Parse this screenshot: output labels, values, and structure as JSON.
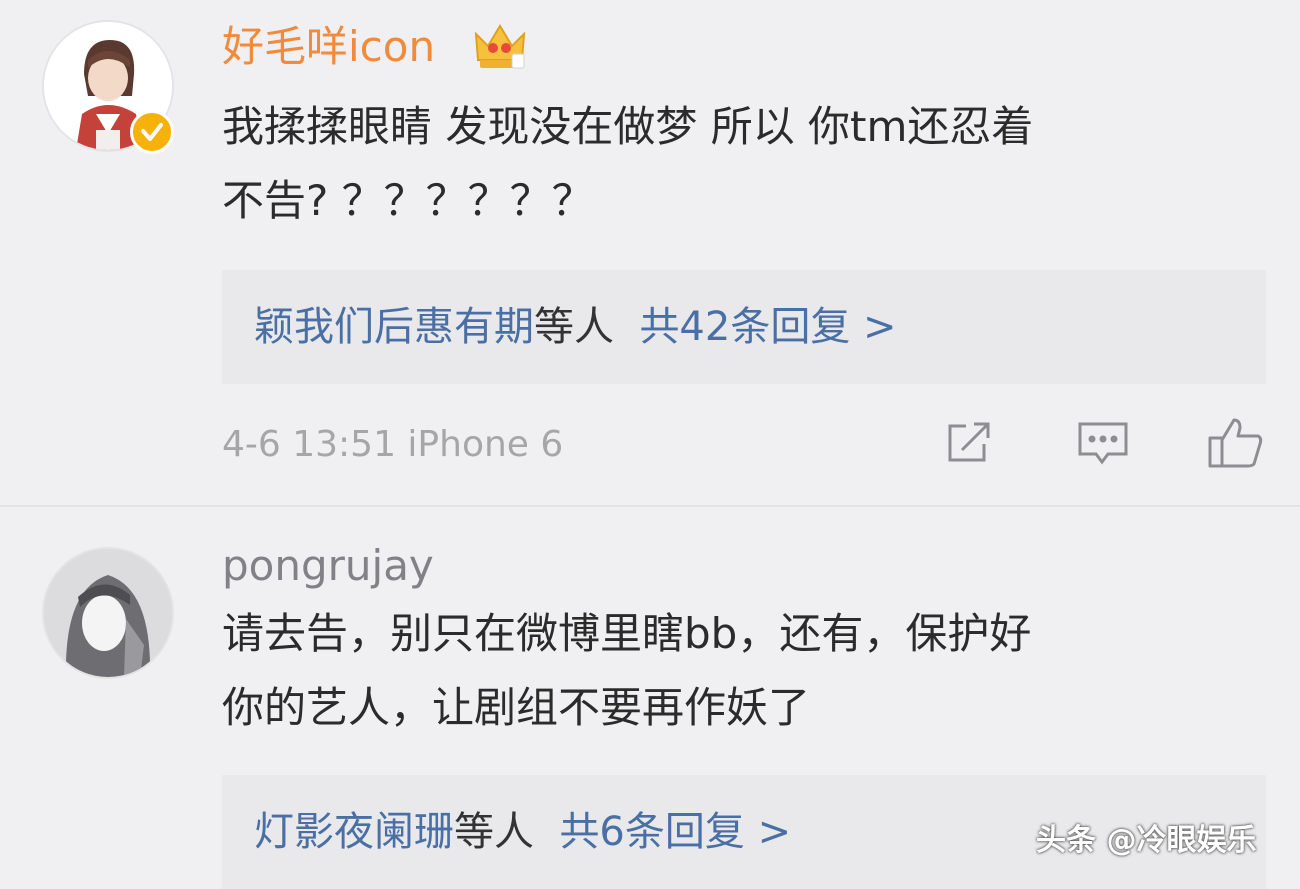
{
  "comments": [
    {
      "username": "好毛咩icon",
      "badge_icon": "crown-icon",
      "verified_icon": "verified-badge-icon",
      "text_line1": "我揉揉眼睛 发现没在做梦 所以 你tm还忍着",
      "text_line2": "不告? ？？？？？？",
      "replies_names": "颖我们后惠有期",
      "replies_suffix": "等人",
      "replies_count": "共42条回复 >",
      "meta": "4-6 13:51 iPhone 6",
      "actions": [
        "share-icon",
        "comment-icon",
        "like-icon"
      ]
    },
    {
      "username": "pongrujay",
      "text_line1": "请去告，别只在微博里瞎bb，还有，保护好",
      "text_line2": "你的艺人，让剧组不要再作妖了",
      "replies_names": "灯影夜阑珊",
      "replies_suffix": "等人",
      "replies_count": "共6条回复 >"
    }
  ],
  "watermark": "头条 @冷眼娱乐",
  "colors": {
    "username_orange": "#f08a3c",
    "link_blue": "#4a6fa5",
    "meta_grey": "#a6a6a8",
    "background": "#f0f0f2"
  }
}
